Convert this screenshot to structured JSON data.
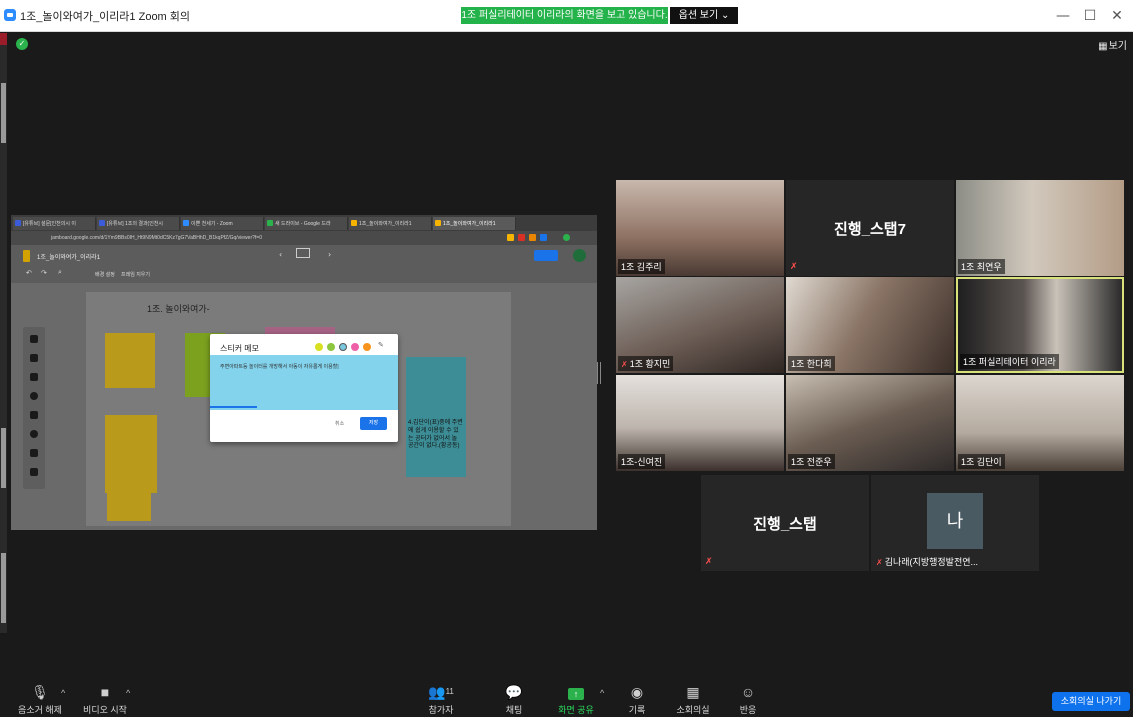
{
  "window": {
    "title": "1조_놀이와여가_이리라1  Zoom 회의",
    "share_banner": "1조 퍼실리테이터 이리라의 화면을 보고 있습니다.",
    "view_options": "옵션 보기 ⌄",
    "controls": {
      "minimize": "—",
      "maximize": "☐",
      "close": "✕"
    }
  },
  "meeting": {
    "gallery_view": "보기",
    "gallery_icon": "grid-icon"
  },
  "shared_screen": {
    "tabs": [
      {
        "label": "[유튜브] 설문[인천의시 이",
        "color": "#3b5bd9"
      },
      {
        "label": "[유튜브] 1조의 결과(인천시",
        "color": "#3b5bd9"
      },
      {
        "label": "이쁜 천세기 - Zoom",
        "color": "#2d8cff"
      },
      {
        "label": "새 드라이브 - Google 드라",
        "color": "#2bb24c"
      },
      {
        "label": "1조_놀이와여가_이리라1",
        "color": "#f4b400"
      },
      {
        "label": "1조_놀이와여가_이리라1",
        "color": "#f4b400"
      }
    ],
    "url": "jamboard.google.com/d/1Ym9BBs0IH_Ht9N9Mt0dC5Kz7gG7VaBHhD_B1kqPfZ/Gq/viewer?f=0",
    "jam_title": "1조_놀이와여가_이리라1",
    "toolbar_labels": [
      "배경 설정",
      "프레임 지우기"
    ],
    "canvas_title": "1조. 놀이와여가-",
    "dialog": {
      "title": "스티커 메모",
      "memo_text": "주변아파트등 놀이터를 개방해서 아동이 자유롭게 이용할|",
      "cancel": "취소",
      "save": "저장",
      "colors": [
        "#d9e021",
        "#8dc63f",
        "#7cc8e0",
        "#ef5fa7",
        "#f7941d"
      ]
    },
    "note_big_text": "4.김단이(표)중에 주변에 쉽게 이용할 수 있는 공터가 없어서 놀 공간이 없다.(황공동)"
  },
  "tiles": [
    {
      "name": "1조 김주리",
      "muted": false,
      "bg": "#a38f7e"
    },
    {
      "name": "진행_스탭7",
      "muted": true,
      "bg": "#262626",
      "center": true
    },
    {
      "name": "1조 최연우",
      "muted": false,
      "bg": "#b8ada1"
    },
    {
      "name": "1조 황지민",
      "muted": true,
      "bg": "#8a847f"
    },
    {
      "name": "1조 한다희",
      "muted": false,
      "bg": "#6e6257"
    },
    {
      "name": "1조 퍼실리테이터 이리라",
      "muted": false,
      "bg": "#4a4745",
      "active": true
    },
    {
      "name": "1조-신여진",
      "muted": false,
      "bg": "#c2b9b1"
    },
    {
      "name": "1조 전준우",
      "muted": false,
      "bg": "#8f867b"
    },
    {
      "name": "1조 김단이",
      "muted": false,
      "bg": "#b3aba1"
    },
    {
      "name": "진행_스탭",
      "muted": true,
      "bg": "#262626",
      "center": true
    },
    {
      "name": "김나래(지방행정발전연...",
      "muted": true,
      "bg": "#262626",
      "avatar": "나"
    }
  ],
  "toolbar": {
    "mute": "음소거 해제",
    "video": "비디오 시작",
    "participants": "참가자",
    "participants_count": "11",
    "chat": "채팅",
    "share": "화면 공유",
    "record": "기록",
    "breakout": "소회의실",
    "reactions": "반응",
    "leave_breakout": "소회의실 나가기",
    "caret": "^"
  }
}
